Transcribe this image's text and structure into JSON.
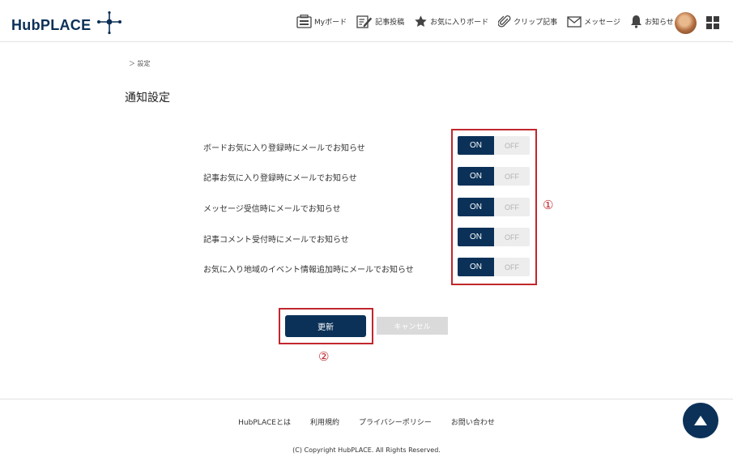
{
  "header": {
    "logo_text": "HubPLACE",
    "nav": [
      {
        "label": "Myボード",
        "icon": "board-icon"
      },
      {
        "label": "記事投稿",
        "icon": "edit-icon"
      },
      {
        "label": "お気に入りボード",
        "icon": "star-icon"
      },
      {
        "label": "クリップ記事",
        "icon": "paperclip-icon"
      },
      {
        "label": "メッセージ",
        "icon": "mail-icon"
      },
      {
        "label": "お知らせ",
        "icon": "bell-icon"
      }
    ]
  },
  "breadcrumb": "＞ 設定",
  "page_title": "通知設定",
  "settings": [
    {
      "label": "ボードお気に入り登録時にメールでお知らせ",
      "on": "ON",
      "off": "OFF",
      "state": "ON"
    },
    {
      "label": "記事お気に入り登録時にメールでお知らせ",
      "on": "ON",
      "off": "OFF",
      "state": "ON"
    },
    {
      "label": "メッセージ受信時にメールでお知らせ",
      "on": "ON",
      "off": "OFF",
      "state": "ON"
    },
    {
      "label": "記事コメント受付時にメールでお知らせ",
      "on": "ON",
      "off": "OFF",
      "state": "ON"
    },
    {
      "label": "お気に入り地域のイベント情報追加時にメールでお知らせ",
      "on": "ON",
      "off": "OFF",
      "state": "ON"
    }
  ],
  "annotations": {
    "one": "①",
    "two": "②"
  },
  "buttons": {
    "update": "更新",
    "cancel": "キャンセル"
  },
  "footer": {
    "links": [
      "HubPLACEとは",
      "利用規約",
      "プライバシーポリシー",
      "お問い合わせ"
    ],
    "copyright": "(C) Copyright HubPLACE. All Rights Reserved."
  },
  "colors": {
    "primary": "#0b3158",
    "annotation": "#c1272d",
    "toggle_off_bg": "#ededed",
    "cancel_bg": "#dadada"
  }
}
